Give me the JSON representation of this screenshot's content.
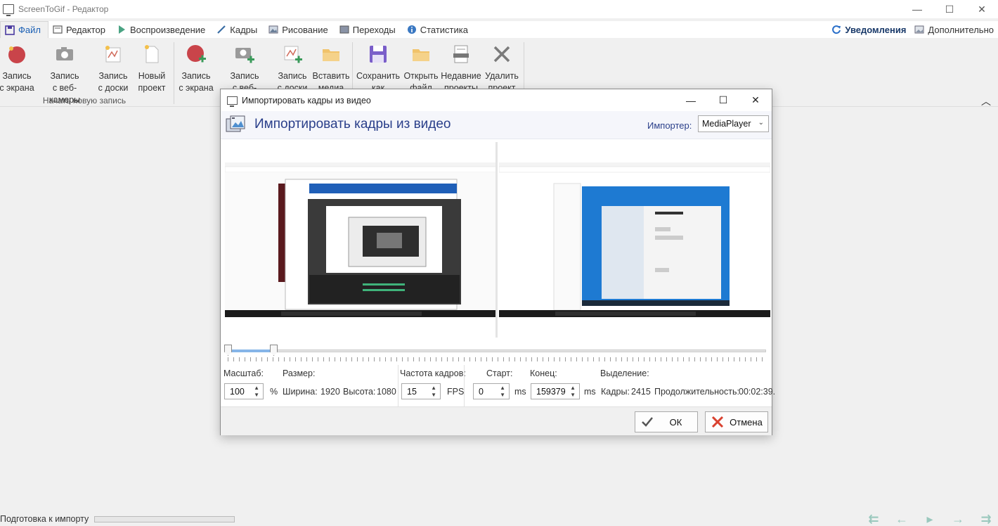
{
  "window": {
    "title": "ScreenToGif - Редактор",
    "minimize": "—",
    "maximize": "☐",
    "close": "✕"
  },
  "tabs": [
    {
      "label": "Файл",
      "icon": "save-icon"
    },
    {
      "label": "Редактор",
      "icon": "editor-icon"
    },
    {
      "label": "Воспроизведение",
      "icon": "play-icon"
    },
    {
      "label": "Кадры",
      "icon": "pencil-icon"
    },
    {
      "label": "Рисование",
      "icon": "image-icon"
    },
    {
      "label": "Переходы",
      "icon": "transitions-icon"
    },
    {
      "label": "Статистика",
      "icon": "info-icon"
    }
  ],
  "tabs_right": [
    {
      "label": "Уведомления",
      "icon": "refresh-icon"
    },
    {
      "label": "Дополнительно",
      "icon": "image-icon"
    }
  ],
  "ribbon": {
    "group_new_label": "Начать новую запись",
    "buttons": [
      {
        "line1": "Запись",
        "line2": "с экрана",
        "icon": "record-screen-icon"
      },
      {
        "line1": "Запись",
        "line2": "с веб-камеры",
        "icon": "webcam-icon"
      },
      {
        "line1": "Запись",
        "line2": "с доски",
        "icon": "board-icon"
      },
      {
        "line1": "Новый",
        "line2": "проект",
        "icon": "new-project-icon"
      },
      {
        "line1": "Запись",
        "line2": "с экрана",
        "icon": "record-screen-add-icon"
      },
      {
        "line1": "Запись",
        "line2": "с веб-камеры",
        "icon": "webcam-add-icon"
      },
      {
        "line1": "Запись",
        "line2": "с доски",
        "icon": "board-add-icon"
      },
      {
        "line1": "Вставить",
        "line2": "медиа",
        "icon": "folder-icon"
      },
      {
        "line1": "Сохранить",
        "line2": "как",
        "icon": "save-icon"
      },
      {
        "line1": "Открыть",
        "line2": "файл",
        "icon": "folder-icon"
      },
      {
        "line1": "Недавние",
        "line2": "проекты",
        "icon": "recent-projects-icon"
      },
      {
        "line1": "Удалить",
        "line2": "проект",
        "icon": "delete-icon"
      }
    ]
  },
  "dialog": {
    "title": "Импортировать кадры из видео",
    "header_title": "Импортировать кадры из видео",
    "importer_label": "Импортер:",
    "importer_value": "MediaPlayer",
    "labels": {
      "scale": "Масштаб:",
      "size": "Размер:",
      "fps": "Частота кадров:",
      "start": "Старт:",
      "end": "Конец:",
      "selection": "Выделение:"
    },
    "values": {
      "scale": "100",
      "scale_unit": "%",
      "width_label": "Ширина:",
      "width": "1920",
      "height_label": "Высота:",
      "height": "1080",
      "fps": "15",
      "fps_unit": "FPS",
      "start": "0",
      "start_unit": "ms",
      "end": "159379",
      "end_unit": "ms",
      "frames_label": "Кадры:",
      "frames": "2415",
      "duration_label": "Продолжительность:",
      "duration": "00:02:39."
    },
    "slider": {
      "selection_end_fraction": 0.085
    },
    "ok_label": "ОК",
    "cancel_label": "Отмена"
  },
  "status": {
    "label": "Подготовка к импорту",
    "progress": 0
  },
  "nav_buttons": [
    "first-frame-icon",
    "previous-frame-icon",
    "play-icon",
    "next-frame-icon",
    "last-frame-icon"
  ],
  "colors": {
    "accent": "#1a5fb4",
    "header_title": "#2a3f8a",
    "record_red": "#c0392b",
    "nav_green": "#9ac8bd"
  }
}
